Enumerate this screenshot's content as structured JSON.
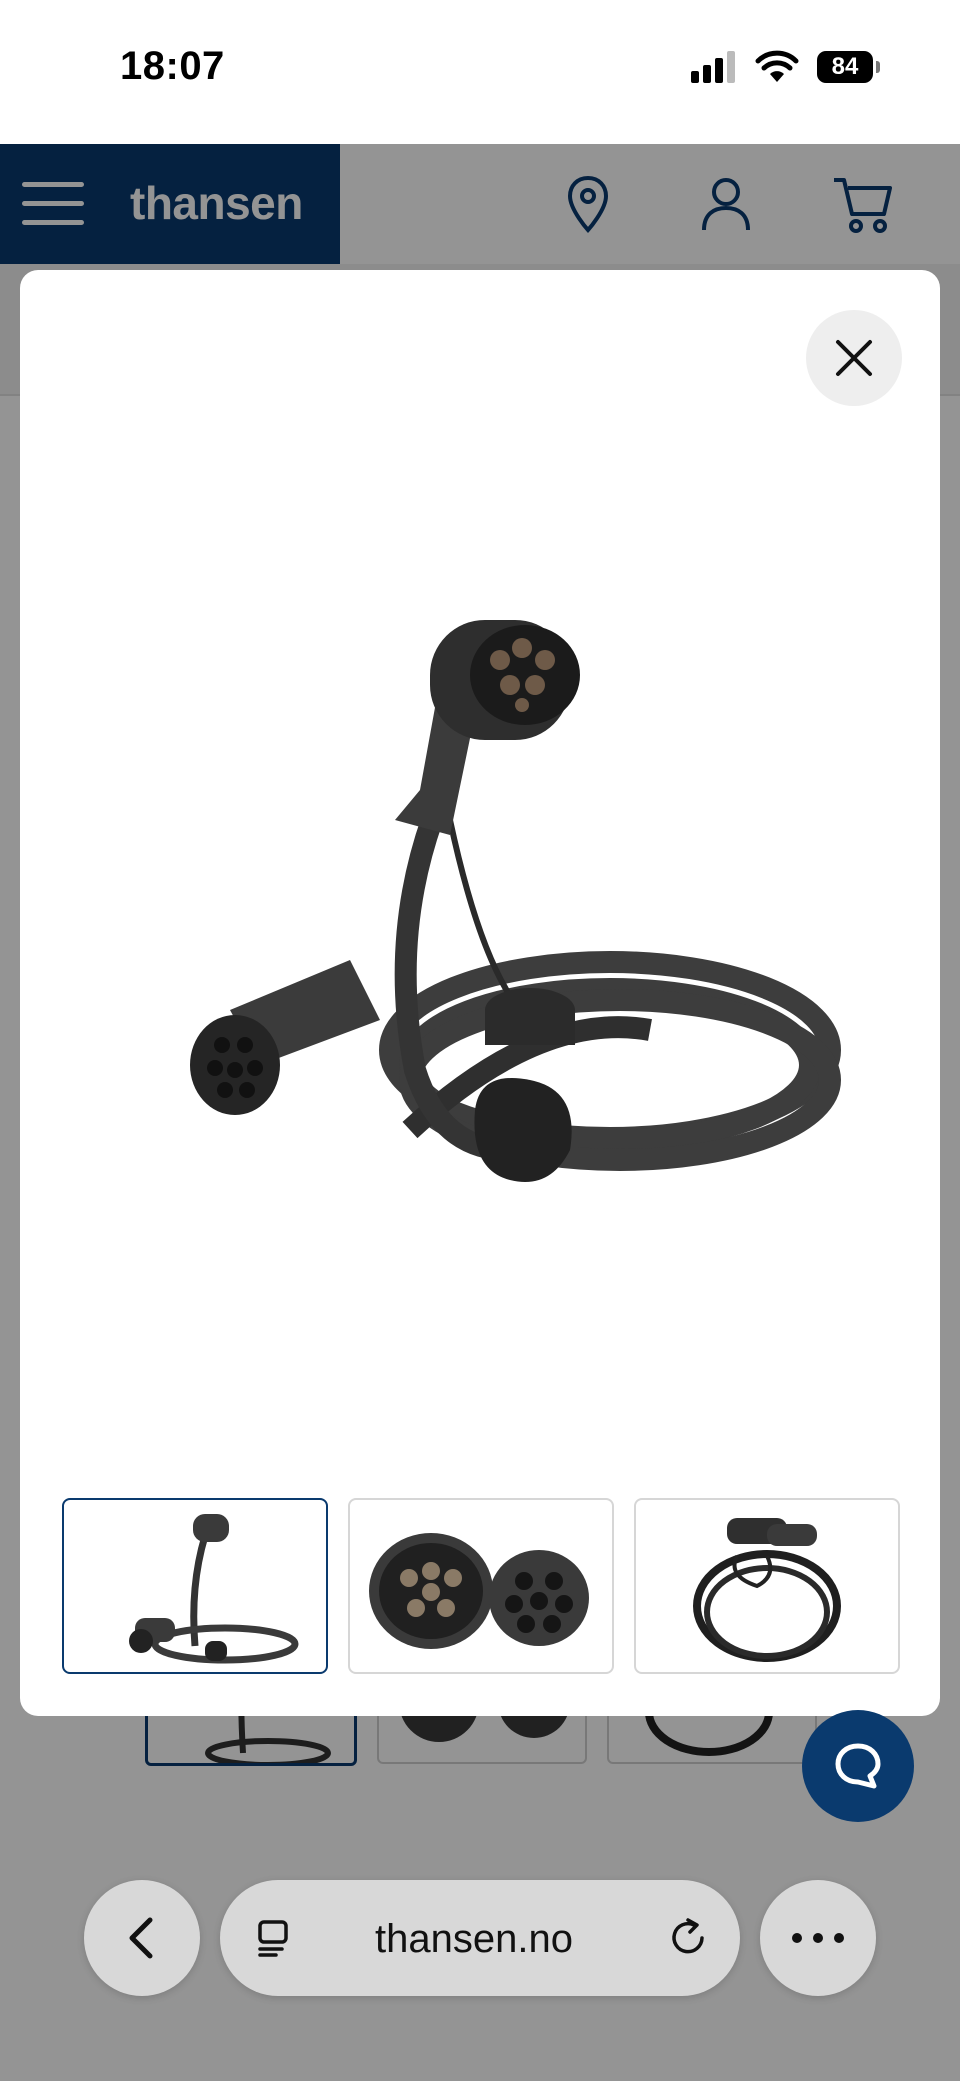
{
  "status_bar": {
    "time": "18:07",
    "battery": "84",
    "icons": [
      "signal-icon",
      "wifi-icon",
      "battery-icon"
    ]
  },
  "header": {
    "logo": "thansen",
    "brand_color": "#0a3a6e",
    "icons": [
      "menu-icon",
      "location-pin-icon",
      "account-icon",
      "cart-icon"
    ]
  },
  "gallery": {
    "main_image": "ev-charging-cable-type2",
    "thumbnails": [
      {
        "name": "ev-cable-coiled",
        "active": true
      },
      {
        "name": "type2-connector-faces",
        "active": false
      },
      {
        "name": "ev-cable-coil-black",
        "active": false
      }
    ]
  },
  "browser": {
    "url": "thansen.no",
    "icons": [
      "back-icon",
      "tabs-icon",
      "reload-icon",
      "more-icon"
    ]
  },
  "chat": {
    "icon": "chat-bubble-icon",
    "color": "#0a3a6e"
  }
}
